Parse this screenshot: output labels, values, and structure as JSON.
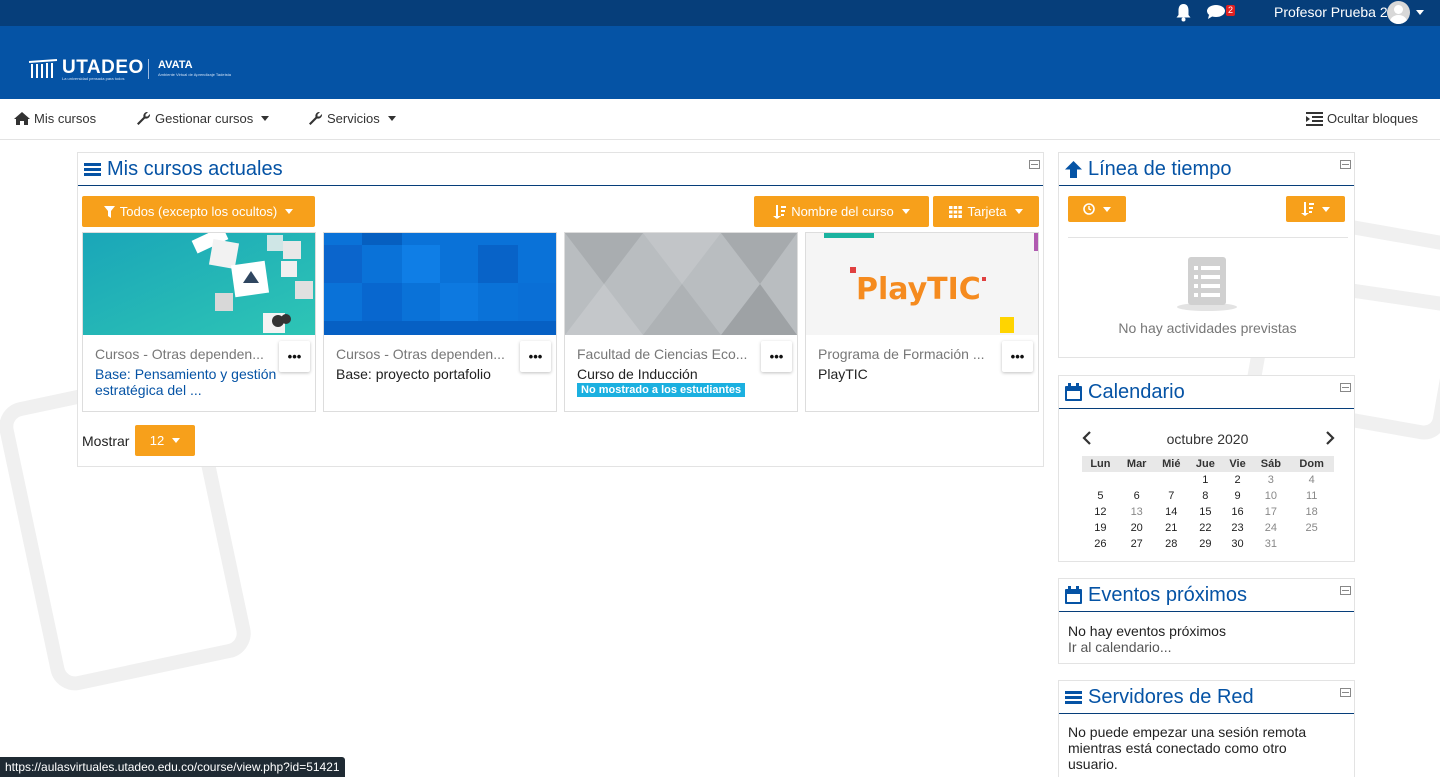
{
  "topbar": {
    "icons": [
      "bell-icon",
      "chat-icon"
    ],
    "message_count": "2",
    "user_name": "Profesor Prueba 2"
  },
  "brand": {
    "logo_text": "UTADEO",
    "logo_sub": "La universidad pensada para todos",
    "product": "AVATA",
    "product_sub": "Ambiente Virtual de Aprendizaje Tadeísta"
  },
  "nav": {
    "my_courses": "Mis cursos",
    "manage_courses": "Gestionar cursos",
    "services": "Servicios",
    "hide_blocks": "Ocultar bloques"
  },
  "main": {
    "title": "Mis cursos actuales",
    "filter_label": "Todos (excepto los ocultos)",
    "sort_label": "Nombre del curso",
    "view_label": "Tarjeta",
    "show_label": "Mostrar",
    "show_count": "12",
    "courses": [
      {
        "category": "Cursos - Otras dependen...",
        "name": "Base: Pensamiento y gestión estratégica del ...",
        "menu": "•••",
        "badge": ""
      },
      {
        "category": "Cursos - Otras dependen...",
        "name": "Base: proyecto portafolio",
        "menu": "•••",
        "badge": ""
      },
      {
        "category": "Facultad de Ciencias Eco...",
        "name": "Curso de Inducción",
        "menu": "•••",
        "badge": "No mostrado a los estudiantes"
      },
      {
        "category": "Programa de Formación ...",
        "name": "PlayTIC",
        "menu": "•••",
        "badge": ""
      }
    ],
    "playtic_logo": "PlayTIC"
  },
  "timeline": {
    "title": "Línea de tiempo",
    "empty": "No hay actividades previstas"
  },
  "calendar": {
    "title": "Calendario",
    "month": "octubre 2020",
    "weekdays": [
      "Lun",
      "Mar",
      "Mié",
      "Jue",
      "Vie",
      "Sáb",
      "Dom"
    ],
    "weeks": [
      [
        "",
        "",
        "",
        "1",
        "2",
        "3",
        "4"
      ],
      [
        "5",
        "6",
        "7",
        "8",
        "9",
        "10",
        "11"
      ],
      [
        "12",
        "13",
        "14",
        "15",
        "16",
        "17",
        "18"
      ],
      [
        "19",
        "20",
        "21",
        "22",
        "23",
        "24",
        "25"
      ],
      [
        "26",
        "27",
        "28",
        "29",
        "30",
        "31",
        ""
      ]
    ]
  },
  "events": {
    "title": "Eventos próximos",
    "empty": "No hay eventos próximos",
    "link": "Ir al calendario..."
  },
  "network": {
    "title": "Servidores de Red",
    "text": "No puede empezar una sesión remota mientras está conectado como otro usuario."
  },
  "status_url": "https://aulasvirtuales.utadeo.edu.co/course/view.php?id=51421",
  "colors": {
    "topbar": "#063e7a",
    "brand": "#0553a5",
    "accent": "#f7a01b",
    "badge": "#1bb0e0"
  }
}
